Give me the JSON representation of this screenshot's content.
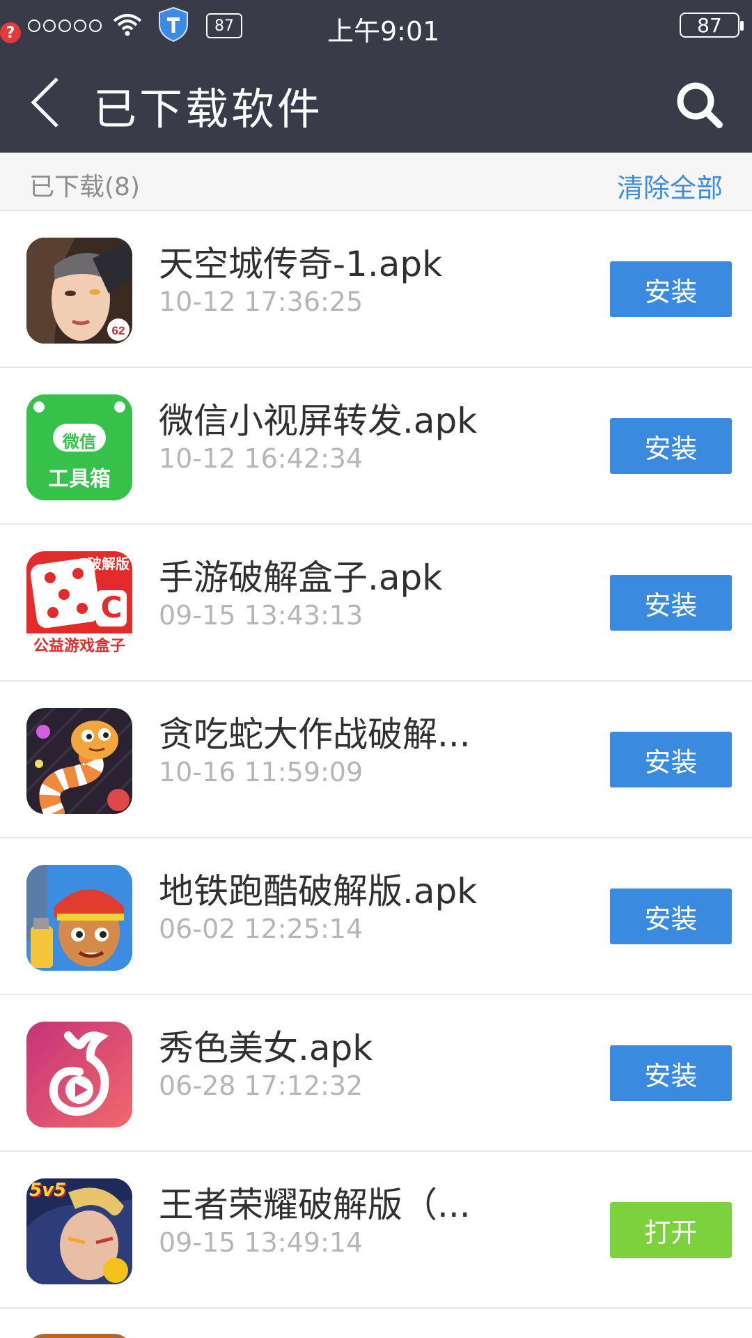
{
  "status_bar": {
    "notification_badge": "?",
    "small_battery": "87",
    "time": "上午9:01",
    "battery": "87"
  },
  "header": {
    "title": "已下载软件"
  },
  "subbar": {
    "count_label": "已下载(8)",
    "clear_all": "清除全部"
  },
  "items": [
    {
      "name": "天空城传奇-1.apk",
      "time": "10-12 17:36:25",
      "action": "安装",
      "icon": "sky-city-legend-icon"
    },
    {
      "name": "微信小视屏转发.apk",
      "time": "10-12 16:42:34",
      "action": "安装",
      "icon": "wechat-toolbox-icon",
      "icon_text_top": "微信",
      "icon_text_bottom": "工具箱"
    },
    {
      "name": "手游破解盒子.apk",
      "time": "09-15 13:43:13",
      "action": "安装",
      "icon": "game-crack-box-icon",
      "icon_text_top": "破解版",
      "icon_text_bottom": "公益游戏盒子",
      "icon_letter": "C"
    },
    {
      "name": "贪吃蛇大作战破解...",
      "time": "10-16 11:59:09",
      "action": "安装",
      "icon": "snake-game-icon"
    },
    {
      "name": "地铁跑酷破解版.apk",
      "time": "06-02 12:25:14",
      "action": "安装",
      "icon": "subway-surfers-icon"
    },
    {
      "name": "秀色美女.apk",
      "time": "06-28 17:12:32",
      "action": "安装",
      "icon": "xiuse-icon"
    },
    {
      "name": "王者荣耀破解版（...",
      "time": "09-15 13:49:14",
      "action": "打开",
      "icon": "honor-of-kings-icon",
      "icon_text_top": "5v5"
    }
  ],
  "colors": {
    "header_bg": "#3a3b48",
    "install_button": "#3a8be0",
    "open_button": "#7cd23d",
    "link": "#3c8ddf"
  }
}
